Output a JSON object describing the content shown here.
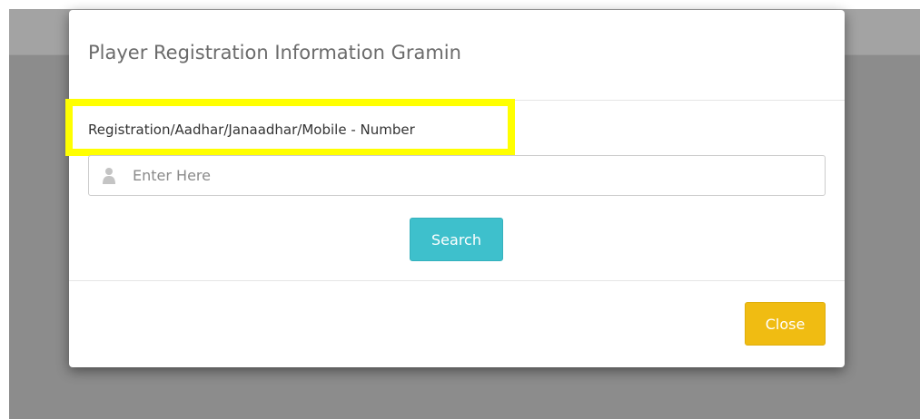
{
  "modal": {
    "title": "Player Registration Information Gramin",
    "field_label": "Registration/Aadhar/Janaadhar/Mobile - Number",
    "search_input": {
      "value": "",
      "placeholder": "Enter Here",
      "icon": "user-icon"
    },
    "search_button_label": "Search",
    "close_button_label": "Close"
  },
  "colors": {
    "highlight": "#ffff00",
    "search_button": "#3ec0cc",
    "close_button": "#f0bc12",
    "backdrop": "#8c8c8c"
  }
}
